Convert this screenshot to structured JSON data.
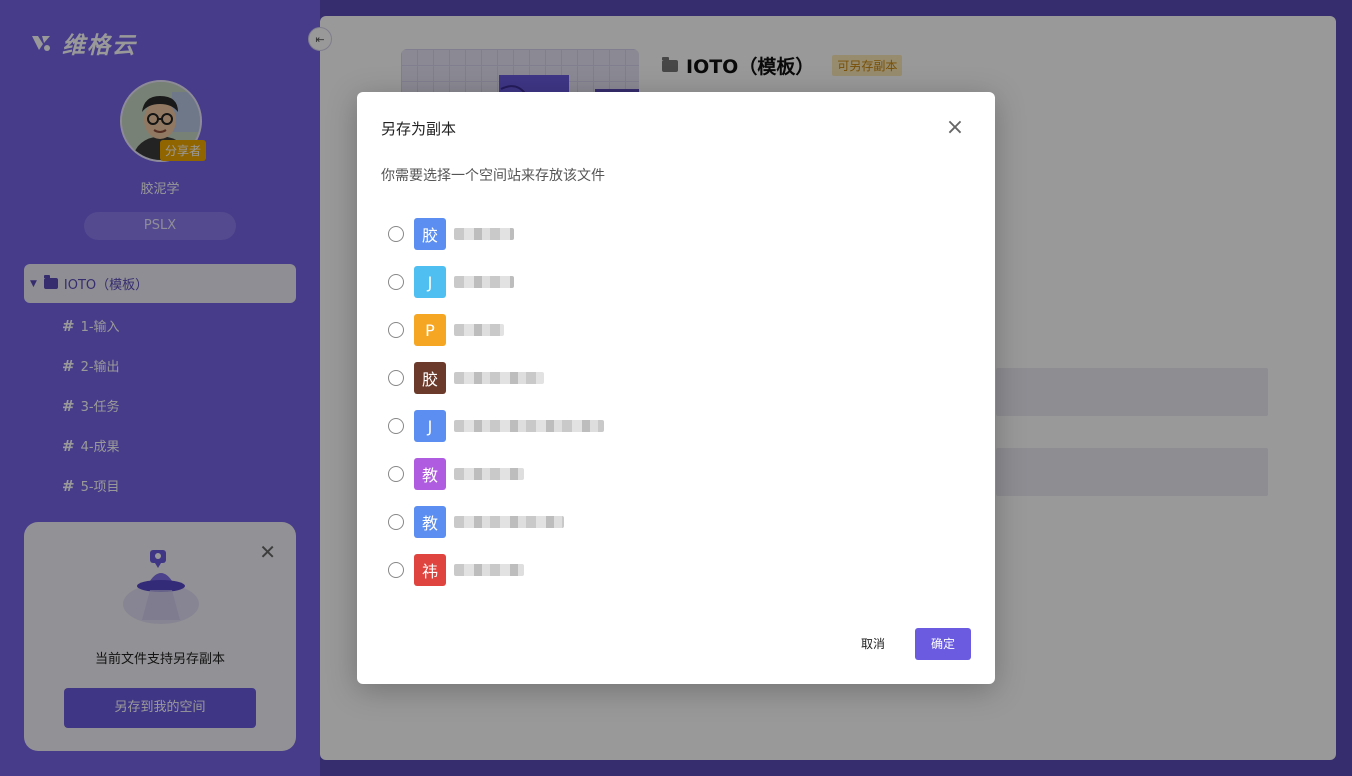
{
  "app": {
    "brand": "维格云"
  },
  "sidebar": {
    "collapse_icon": "collapse-sidebar-icon",
    "user": {
      "name": "胶泥学",
      "badge": "分享者",
      "code": "PSLX"
    },
    "tree": {
      "root": {
        "label": "IOTO（模板）"
      },
      "items": [
        {
          "label": "1-输入"
        },
        {
          "label": "2-输出"
        },
        {
          "label": "3-任务"
        },
        {
          "label": "4-成果"
        },
        {
          "label": "5-项目"
        }
      ]
    },
    "promo": {
      "text": "当前文件支持另存副本",
      "button": "另存到我的空间"
    }
  },
  "main": {
    "doc_title": "IOTO（模板）",
    "badge": "可另存副本"
  },
  "dialog": {
    "title": "另存为副本",
    "description": "你需要选择一个空间站来存放该文件",
    "spaces": [
      {
        "initial": "胶",
        "color": "#5b8ef0",
        "name": "██████"
      },
      {
        "initial": "J",
        "color": "#4fbff2",
        "name": "██████"
      },
      {
        "initial": "P",
        "color": "#f5a623",
        "name": "█████"
      },
      {
        "initial": "胶",
        "color": "#6b3a2a",
        "name": "█████████"
      },
      {
        "initial": "J",
        "color": "#5b8ef0",
        "name": "███████████████"
      },
      {
        "initial": "教",
        "color": "#b05ce0",
        "name": "███████"
      },
      {
        "initial": "教",
        "color": "#5b8ef0",
        "name": "███████████"
      },
      {
        "initial": "祎",
        "color": "#e0443e",
        "name": "███████"
      }
    ],
    "cancel": "取消",
    "confirm": "确定"
  }
}
